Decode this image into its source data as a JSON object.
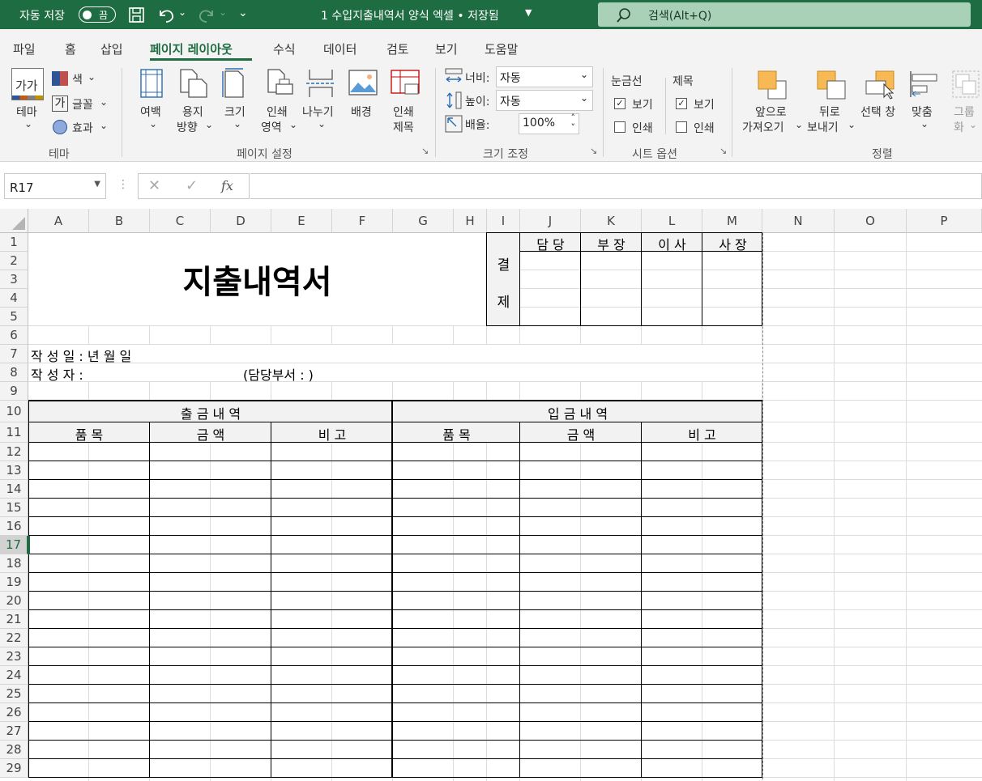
{
  "titlebar": {
    "autosave": "자동 저장",
    "toggle": "끔",
    "doc_title": "1 수입지출내역서 양식 엑셀 • 저장됨",
    "search": "검색(Alt+Q)"
  },
  "menu": [
    "파일",
    "홈",
    "삽입",
    "페이지 레이아웃",
    "수식",
    "데이터",
    "검토",
    "보기",
    "도움말"
  ],
  "ribbon": {
    "theme": {
      "themes": "테마",
      "colors": "색",
      "fonts": "글꼴",
      "effects": "효과",
      "group": "테마"
    },
    "page_setup": {
      "margins": "여백",
      "orientation_1": "용지",
      "orientation_2": "방향",
      "size": "크기",
      "print_area_1": "인쇄",
      "print_area_2": "영역",
      "breaks": "나누기",
      "background": "배경",
      "print_titles_1": "인쇄",
      "print_titles_2": "제목",
      "group": "페이지 설정"
    },
    "scale": {
      "width_label": "너비:",
      "width_value": "자동",
      "height_label": "높이:",
      "height_value": "자동",
      "scale_label": "배율:",
      "scale_value": "100%",
      "group": "크기 조정"
    },
    "sheet_options": {
      "gridlines": "눈금선",
      "headings": "제목",
      "view": "보기",
      "print": "인쇄",
      "group": "시트 옵션"
    },
    "arrange": {
      "bring_forward_1": "앞으로",
      "bring_forward_2": "가져오기",
      "send_backward_1": "뒤로",
      "send_backward_2": "보내기",
      "selection_pane": "선택 창",
      "align": "맞춤",
      "group_1": "그룹",
      "group_2": "화",
      "group": "정렬"
    }
  },
  "formula_bar": {
    "name_box": "R17",
    "fx": "fx"
  },
  "columns": [
    "A",
    "B",
    "C",
    "D",
    "E",
    "F",
    "G",
    "H",
    "I",
    "J",
    "K",
    "L",
    "M",
    "N",
    "O",
    "P"
  ],
  "rows": [
    "1",
    "2",
    "3",
    "4",
    "5",
    "6",
    "7",
    "8",
    "9",
    "10",
    "11",
    "12",
    "13",
    "14",
    "15",
    "16",
    "17",
    "18",
    "19",
    "20",
    "21",
    "22",
    "23",
    "24",
    "25",
    "26",
    "27",
    "28",
    "29"
  ],
  "sheet": {
    "title": "지출내역서",
    "approval_label_1": "결",
    "approval_label_2": "제",
    "approval_roles": [
      "담 당",
      "부 장",
      "이 사",
      "사 장"
    ],
    "date_line": "작 성 일 : 년 월 일",
    "author_line": "작 성 자 :",
    "dept_line": "(담당부서 : )",
    "expense_header": "출 금 내 역",
    "income_header": "입 금 내 역",
    "sub_headers": [
      "품 목",
      "금 액",
      "비 고",
      "품 목",
      "금 액",
      "비 고"
    ]
  }
}
